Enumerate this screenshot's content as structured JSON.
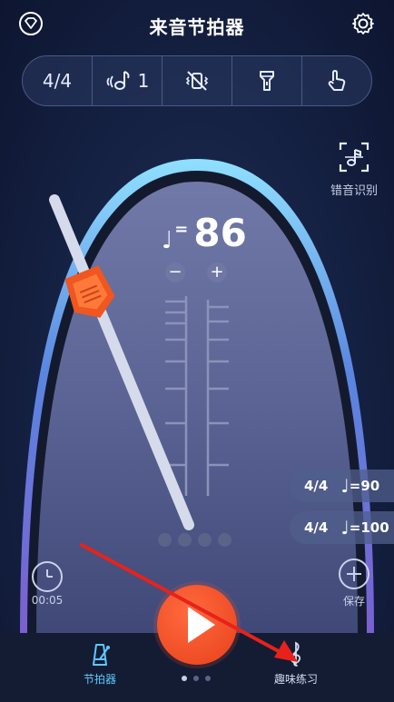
{
  "header": {
    "title": "来音节拍器",
    "logo_icon": "diamond-logo-icon",
    "settings_icon": "gear-icon"
  },
  "toolbar": {
    "time_signature": "4/4",
    "subdivision_value": "1",
    "subdivision_icon": "note-sound-icon",
    "vibration_icon": "vibration-off-icon",
    "flashlight_icon": "flashlight-icon",
    "tap_icon": "tap-hand-icon"
  },
  "error_recognition": {
    "label": "错音识别",
    "icon": "scan-note-icon"
  },
  "metronome": {
    "tempo": "86",
    "tempo_prefix": "=",
    "minus": "−",
    "plus": "+",
    "beats": 4
  },
  "presets": [
    {
      "time_signature": "4/4",
      "bpm": "=90"
    },
    {
      "time_signature": "4/4",
      "bpm": "=100"
    }
  ],
  "timer": {
    "label": "00:05"
  },
  "save": {
    "label": "保存"
  },
  "bottom_nav": {
    "items": [
      {
        "label": "节拍器",
        "active": true
      },
      {
        "label": "趣味练习",
        "active": false
      }
    ],
    "pages": 3,
    "active_page": 0
  },
  "colors": {
    "accent_blue": "#5fc8ff",
    "play_orange": "#ff5a2a",
    "annotation_red": "#e8221a"
  }
}
